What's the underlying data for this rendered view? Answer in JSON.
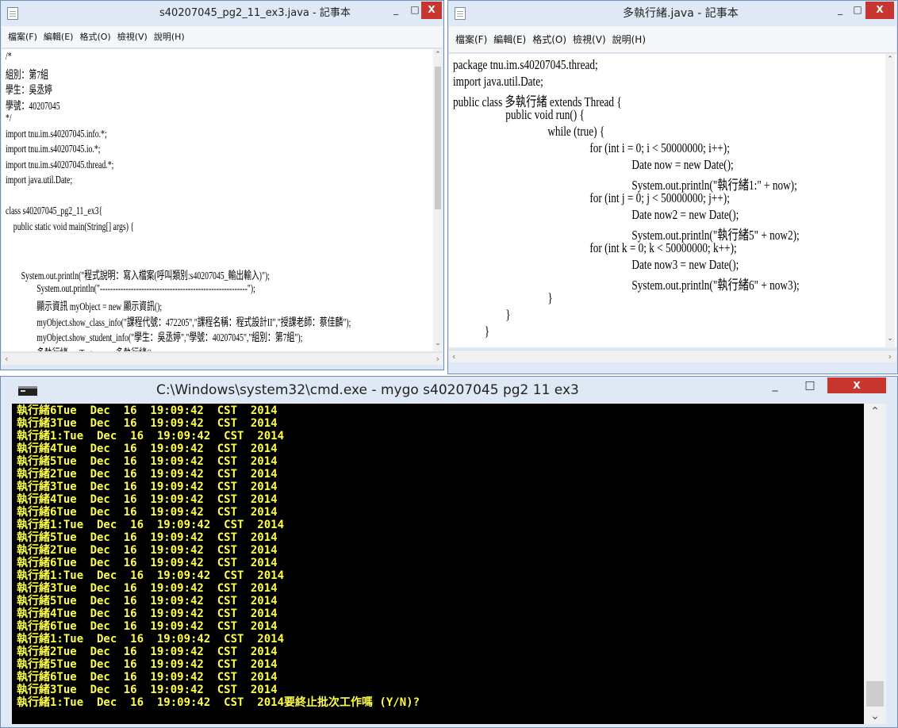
{
  "left_window": {
    "title": "s40207045_pg2_11_ex3.java - 記事本",
    "controls": {
      "minimize": "_",
      "maximize": "□",
      "close": "X"
    },
    "menu": [
      "檔案(F)",
      "編輯(E)",
      "格式(O)",
      "檢視(V)",
      "說明(H)"
    ],
    "lines": [
      "/*",
      "組別：第7組",
      "學生：吳丞婷",
      "學號：40207045",
      "*/",
      "import tnu.im.s40207045.info.*;",
      "import tnu.im.s40207045.io.*;",
      "import tnu.im.s40207045.thread.*;",
      "import java.util.Date;",
      "",
      "class s40207045_pg2_11_ex3{",
      "    public static void main(String[] args) {",
      "",
      "",
      "        System.out.println(\"程式說明：寫入檔案(呼叫類別:s40207045_輸出輸入)\");",
      "                System.out.println(\"---------------------------------------------------------\");",
      "                顯示資訊 myObject = new 顯示資訊();",
      "                myObject.show_class_info(\"課程代號：472205\",\"課程名稱：程式設計II\",\"授課老師：蔡佳麟\");",
      "                myObject.show_student_info(\"學生：吳丞婷\",\"學號：40207045\",\"組別：第7組\");",
      "                多執行緒 myTest = new 多執行緒();"
    ]
  },
  "right_window": {
    "title": "多執行緒.java - 記事本",
    "controls": {
      "minimize": "_",
      "maximize": "□",
      "close": "X"
    },
    "menu": [
      "檔案(F)",
      "編輯(E)",
      "格式(O)",
      "檢視(V)",
      "說明(H)"
    ],
    "lines": [
      "package tnu.im.s40207045.thread;",
      "import java.util.Date;",
      "public class 多執行緒 extends Thread {",
      "                    public void run() {",
      "                                    while (true) {",
      "                                                    for (int i = 0; i < 50000000; i++);",
      "                                                                    Date now = new Date();",
      "                                                                    System.out.println(\"執行緒1:\" + now);",
      "                                                    for (int j = 0; j < 50000000; j++);",
      "                                                                    Date now2 = new Date();",
      "                                                                    System.out.println(\"執行緒5\" + now2);",
      "                                                    for (int k = 0; k < 50000000; k++);",
      "                                                                    Date now3 = new Date();",
      "                                                                    System.out.println(\"執行緒6\" + now3);",
      "                                    }",
      "                    }",
      "            }"
    ]
  },
  "cmd_window": {
    "title": "C:\\Windows\\system32\\cmd.exe - mygo  s40207045 pg2 11 ex3",
    "controls": {
      "minimize": "_",
      "maximize": "□",
      "close": "X"
    },
    "lines": [
      "執行緒6Tue  Dec  16  19:09:42  CST  2014",
      "執行緒3Tue  Dec  16  19:09:42  CST  2014",
      "執行緒1:Tue  Dec  16  19:09:42  CST  2014",
      "執行緒4Tue  Dec  16  19:09:42  CST  2014",
      "執行緒5Tue  Dec  16  19:09:42  CST  2014",
      "執行緒2Tue  Dec  16  19:09:42  CST  2014",
      "執行緒3Tue  Dec  16  19:09:42  CST  2014",
      "執行緒4Tue  Dec  16  19:09:42  CST  2014",
      "執行緒6Tue  Dec  16  19:09:42  CST  2014",
      "執行緒1:Tue  Dec  16  19:09:42  CST  2014",
      "執行緒5Tue  Dec  16  19:09:42  CST  2014",
      "執行緒2Tue  Dec  16  19:09:42  CST  2014",
      "執行緒6Tue  Dec  16  19:09:42  CST  2014",
      "執行緒1:Tue  Dec  16  19:09:42  CST  2014",
      "執行緒3Tue  Dec  16  19:09:42  CST  2014",
      "執行緒5Tue  Dec  16  19:09:42  CST  2014",
      "執行緒4Tue  Dec  16  19:09:42  CST  2014",
      "執行緒6Tue  Dec  16  19:09:42  CST  2014",
      "執行緒1:Tue  Dec  16  19:09:42  CST  2014",
      "執行緒2Tue  Dec  16  19:09:42  CST  2014",
      "執行緒5Tue  Dec  16  19:09:42  CST  2014",
      "執行緒6Tue  Dec  16  19:09:42  CST  2014",
      "執行緒3Tue  Dec  16  19:09:42  CST  2014",
      "執行緒1:Tue  Dec  16  19:09:42  CST  2014要終止批次工作嗎 (Y/N)?"
    ]
  },
  "colors": {
    "console_bg": "#000000",
    "console_text": "#ffff4a",
    "close_button": "#c7372f",
    "window_frame": "#dfe9f5"
  }
}
